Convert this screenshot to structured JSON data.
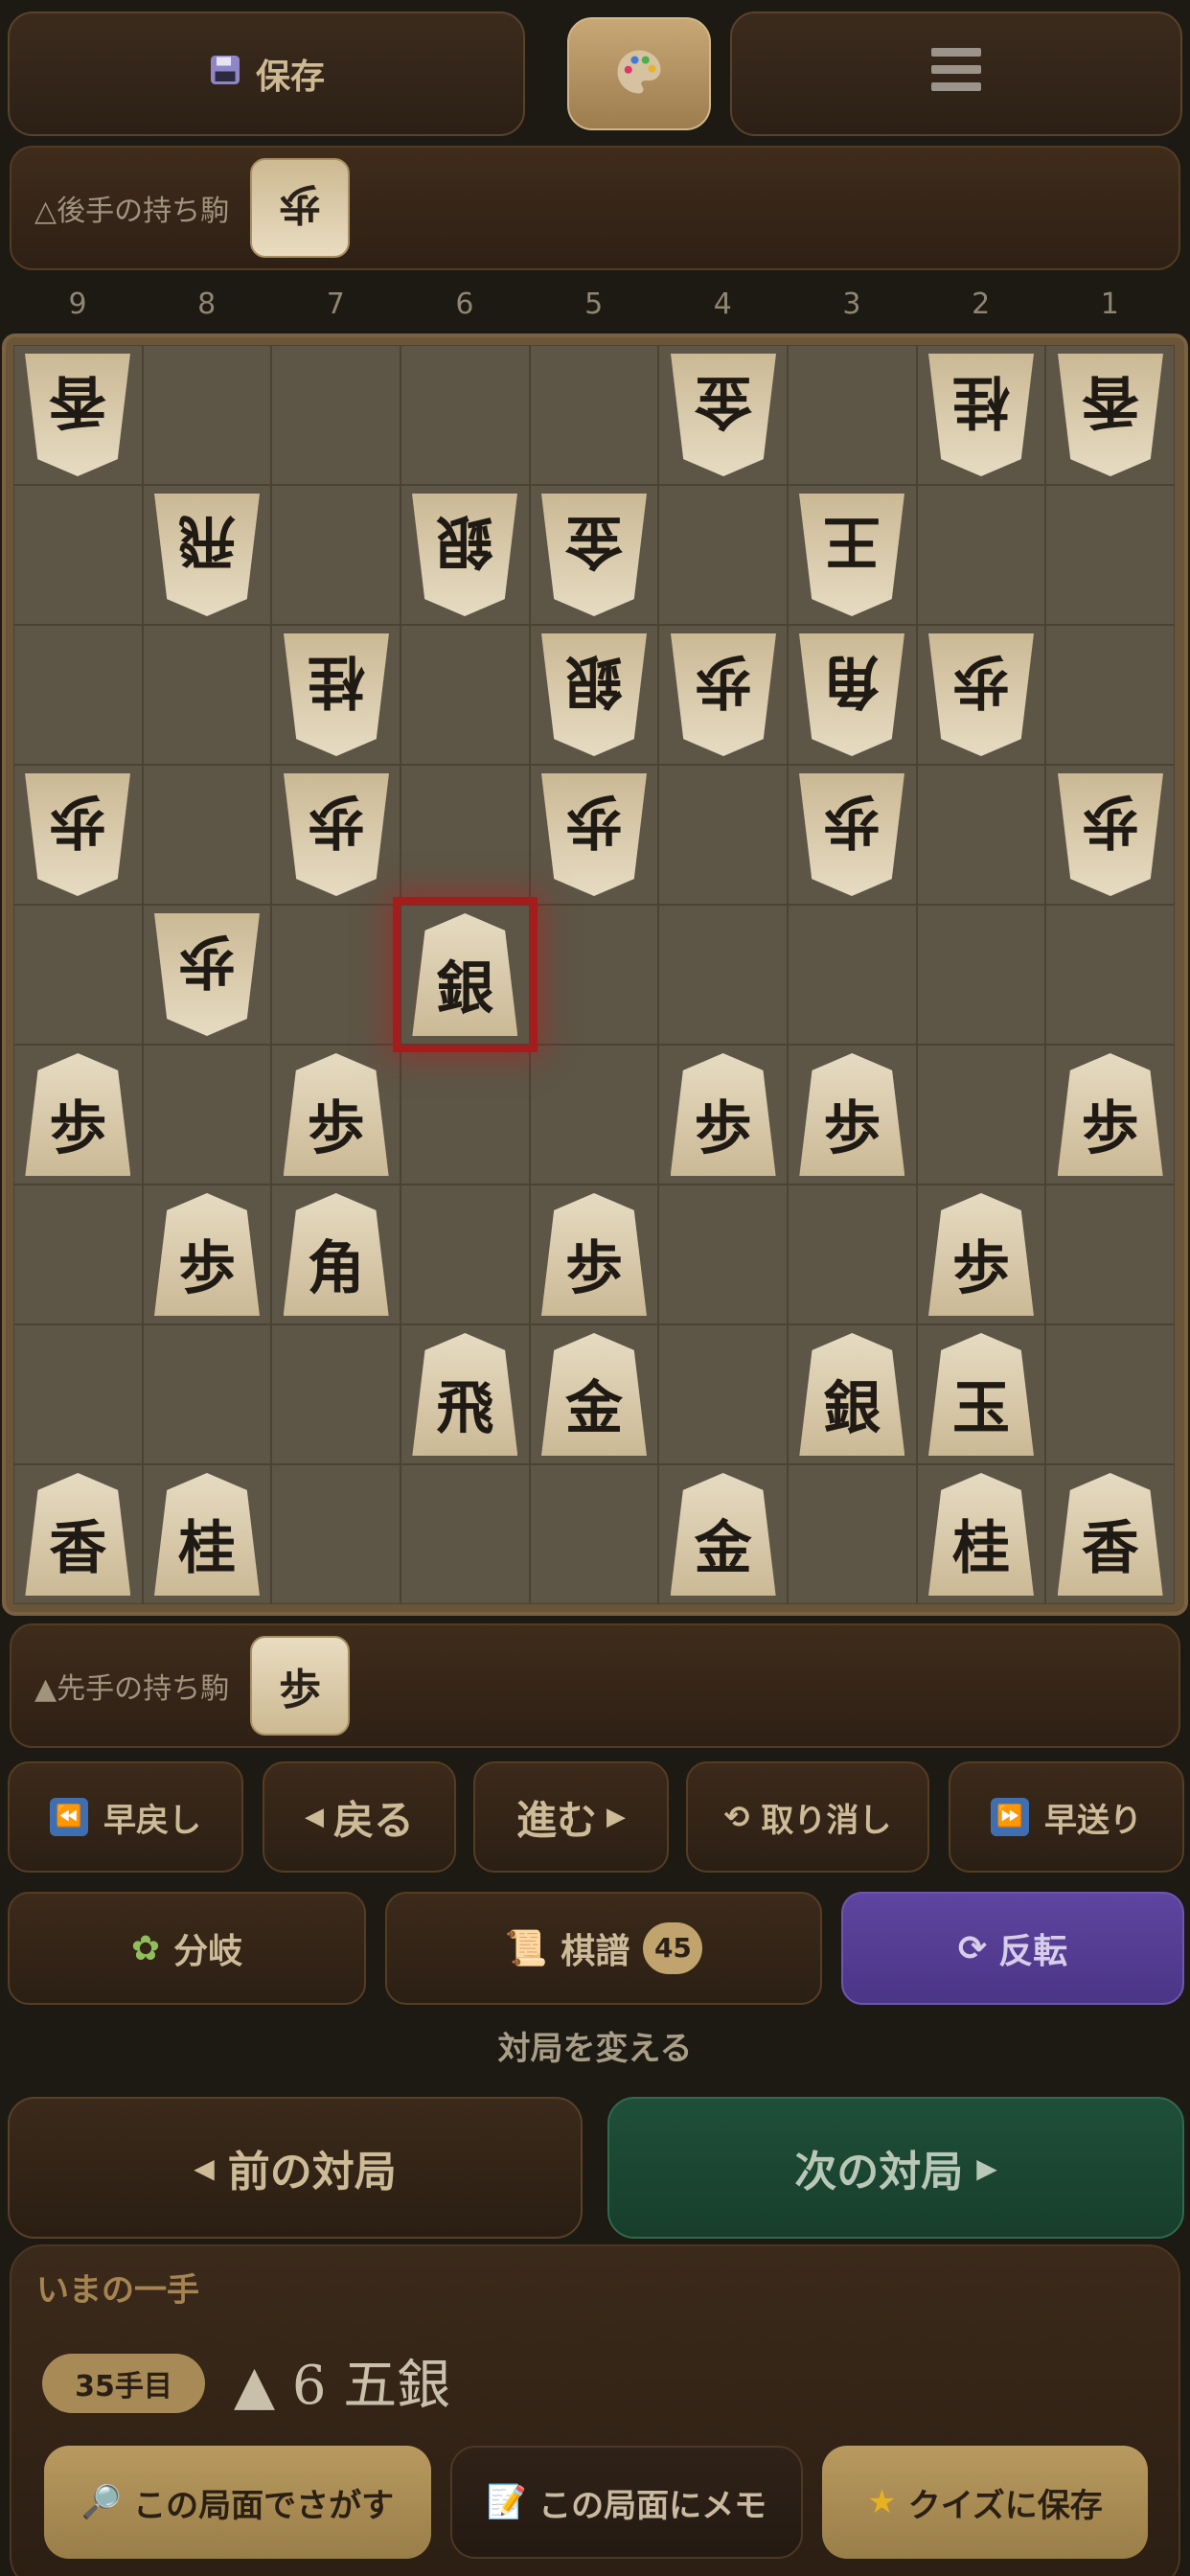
{
  "toolbar": {
    "save_label": "保存",
    "menu_icon": "hamburger-icon",
    "palette_icon": "palette-icon"
  },
  "hands": {
    "gote_label": "△後手の持ち駒",
    "gote_pieces": [
      "歩"
    ],
    "sente_label": "▲先手の持ち駒",
    "sente_pieces": [
      "歩"
    ]
  },
  "board": {
    "file_labels": [
      "9",
      "8",
      "7",
      "6",
      "5",
      "4",
      "3",
      "2",
      "1"
    ],
    "highlight": {
      "row": 4,
      "col": 3
    },
    "cells": [
      [
        {
          "p": "香",
          "g": 1
        },
        null,
        null,
        null,
        null,
        {
          "p": "金",
          "g": 1
        },
        null,
        {
          "p": "桂",
          "g": 1
        },
        {
          "p": "香",
          "g": 1
        }
      ],
      [
        null,
        {
          "p": "飛",
          "g": 1
        },
        null,
        {
          "p": "銀",
          "g": 1
        },
        {
          "p": "金",
          "g": 1
        },
        null,
        {
          "p": "王",
          "g": 1
        },
        null,
        null
      ],
      [
        null,
        null,
        {
          "p": "桂",
          "g": 1
        },
        null,
        {
          "p": "銀",
          "g": 1
        },
        {
          "p": "歩",
          "g": 1
        },
        {
          "p": "角",
          "g": 1
        },
        {
          "p": "歩",
          "g": 1
        },
        null
      ],
      [
        {
          "p": "歩",
          "g": 1
        },
        null,
        {
          "p": "歩",
          "g": 1
        },
        null,
        {
          "p": "歩",
          "g": 1
        },
        null,
        {
          "p": "歩",
          "g": 1
        },
        null,
        {
          "p": "歩",
          "g": 1
        }
      ],
      [
        null,
        {
          "p": "歩",
          "g": 1
        },
        null,
        {
          "p": "銀",
          "g": 0
        },
        null,
        null,
        null,
        null,
        null
      ],
      [
        {
          "p": "歩",
          "g": 0
        },
        null,
        {
          "p": "歩",
          "g": 0
        },
        null,
        null,
        {
          "p": "歩",
          "g": 0
        },
        {
          "p": "歩",
          "g": 0
        },
        null,
        {
          "p": "歩",
          "g": 0
        }
      ],
      [
        null,
        {
          "p": "歩",
          "g": 0
        },
        {
          "p": "角",
          "g": 0
        },
        null,
        {
          "p": "歩",
          "g": 0
        },
        null,
        null,
        {
          "p": "歩",
          "g": 0
        },
        null
      ],
      [
        null,
        null,
        null,
        {
          "p": "飛",
          "g": 0
        },
        {
          "p": "金",
          "g": 0
        },
        null,
        {
          "p": "銀",
          "g": 0
        },
        {
          "p": "玉",
          "g": 0
        },
        null
      ],
      [
        {
          "p": "香",
          "g": 0
        },
        {
          "p": "桂",
          "g": 0
        },
        null,
        null,
        null,
        {
          "p": "金",
          "g": 0
        },
        null,
        {
          "p": "桂",
          "g": 0
        },
        {
          "p": "香",
          "g": 0
        }
      ]
    ]
  },
  "nav": {
    "fast_back": "早戻し",
    "back": "戻る",
    "forward": "進む",
    "undo": "取り消し",
    "fast_forward": "早送り"
  },
  "actions": {
    "branch": "分岐",
    "kifu": "棋譜",
    "kifu_count": "45",
    "flip": "反転"
  },
  "switch_game": {
    "title": "対局を変える",
    "prev": "前の対局",
    "next": "次の対局"
  },
  "current_move": {
    "title": "いまの一手",
    "count": "35手目",
    "move": "▲ 6 五銀"
  },
  "bottom_actions": {
    "search": "この局面でさがす",
    "memo": "この局面にメモ",
    "quiz": "クイズに保存"
  },
  "colors": {
    "accent_green": "#1d4a35",
    "accent_purple": "#5b3f9c",
    "highlight_red": "#a51c1c"
  }
}
